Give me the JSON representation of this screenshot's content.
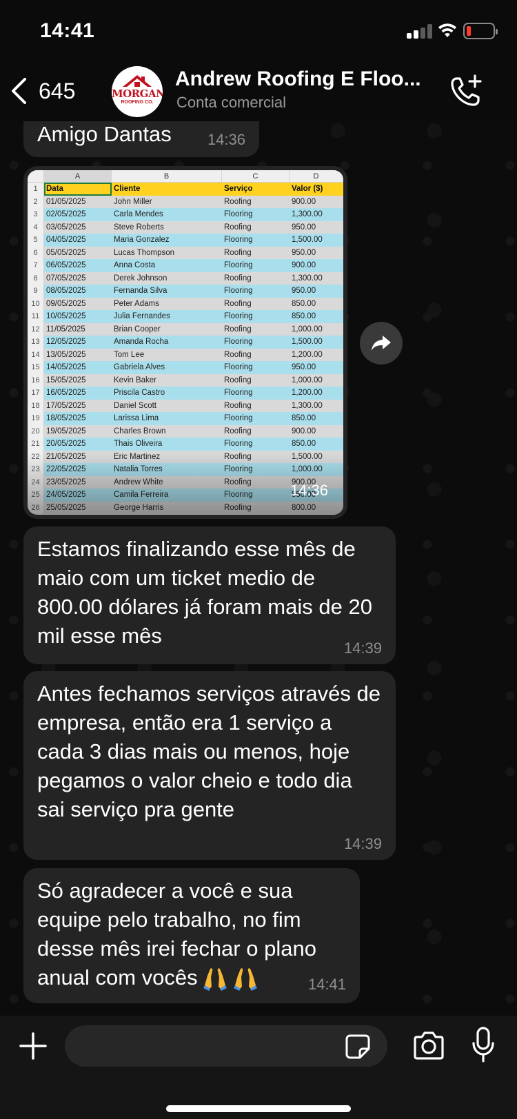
{
  "status_bar": {
    "time": "14:41"
  },
  "header": {
    "back_count": "645",
    "contact_name": "Andrew Roofing E Floo...",
    "contact_subtitle": "Conta comercial",
    "avatar_brand": "MORGAN",
    "avatar_sub": "ROOFING CO."
  },
  "messages": [
    {
      "text": "Amigo Dantas",
      "time": "14:36"
    },
    {
      "type": "image",
      "time": "14:36"
    },
    {
      "text": "Estamos finalizando esse mês de maio com um ticket medio de 800.00 dólares já foram mais de 20 mil esse mês",
      "time": "14:39"
    },
    {
      "text": "Antes fechamos serviços através de empresa, então era 1 serviço a cada 3 dias mais ou menos, hoje pegamos o valor cheio e todo dia sai serviço pra gente",
      "time": "14:39"
    },
    {
      "text": "Só agradecer a você e sua equipe pelo trabalho, no fim desse mês irei fechar o plano anual com vocês",
      "time": "14:41"
    }
  ],
  "sheet": {
    "column_letters": [
      "A",
      "B",
      "C",
      "D"
    ],
    "headers": [
      "Data",
      "Cliente",
      "Serviço",
      "Valor ($)"
    ],
    "rows": [
      [
        "01/05/2025",
        "John Miller",
        "Roofing",
        "900.00"
      ],
      [
        "02/05/2025",
        "Carla Mendes",
        "Flooring",
        "1,300.00"
      ],
      [
        "03/05/2025",
        "Steve Roberts",
        "Roofing",
        "950.00"
      ],
      [
        "04/05/2025",
        "Maria Gonzalez",
        "Flooring",
        "1,500.00"
      ],
      [
        "05/05/2025",
        "Lucas Thompson",
        "Roofing",
        "950.00"
      ],
      [
        "06/05/2025",
        "Anna Costa",
        "Flooring",
        "900.00"
      ],
      [
        "07/05/2025",
        "Derek Johnson",
        "Roofing",
        "1,300.00"
      ],
      [
        "08/05/2025",
        "Fernanda Silva",
        "Flooring",
        "950.00"
      ],
      [
        "09/05/2025",
        "Peter Adams",
        "Roofing",
        "850.00"
      ],
      [
        "10/05/2025",
        "Julia Fernandes",
        "Flooring",
        "850.00"
      ],
      [
        "11/05/2025",
        "Brian Cooper",
        "Roofing",
        "1,000.00"
      ],
      [
        "12/05/2025",
        "Amanda Rocha",
        "Flooring",
        "1,500.00"
      ],
      [
        "13/05/2025",
        "Tom Lee",
        "Roofing",
        "1,200.00"
      ],
      [
        "14/05/2025",
        "Gabriela Alves",
        "Flooring",
        "950.00"
      ],
      [
        "15/05/2025",
        "Kevin Baker",
        "Roofing",
        "1,000.00"
      ],
      [
        "16/05/2025",
        "Priscila Castro",
        "Flooring",
        "1,200.00"
      ],
      [
        "17/05/2025",
        "Daniel Scott",
        "Roofing",
        "1,300.00"
      ],
      [
        "18/05/2025",
        "Larissa Lima",
        "Flooring",
        "850.00"
      ],
      [
        "19/05/2025",
        "Charles Brown",
        "Roofing",
        "900.00"
      ],
      [
        "20/05/2025",
        "Thais Oliveira",
        "Flooring",
        "850.00"
      ],
      [
        "21/05/2025",
        "Eric Martinez",
        "Roofing",
        "1,500.00"
      ],
      [
        "22/05/2025",
        "Natalia Torres",
        "Flooring",
        "1,000.00"
      ],
      [
        "23/05/2025",
        "Andrew White",
        "Roofing",
        "900.00"
      ],
      [
        "24/05/2025",
        "Camila Ferreira",
        "Flooring",
        "850.00"
      ],
      [
        "25/05/2025",
        "George Harris",
        "Roofing",
        "800.00"
      ]
    ]
  },
  "icons": {
    "back": "chevron-left-icon",
    "call": "phone-plus-icon",
    "forward": "forward-arrow-icon",
    "plus": "plus-icon",
    "sticker": "sticker-icon",
    "camera": "camera-icon",
    "mic": "microphone-icon",
    "emoji": "folded-hands-emoji"
  },
  "colors": {
    "bubble": "#242424",
    "sheet_header": "#ffd21f",
    "sheet_alt_row": "#a9dfec",
    "sheet_plain_row": "#d9d9d9",
    "battery_low": "#ff3b30",
    "brand_red": "#c1121f"
  }
}
